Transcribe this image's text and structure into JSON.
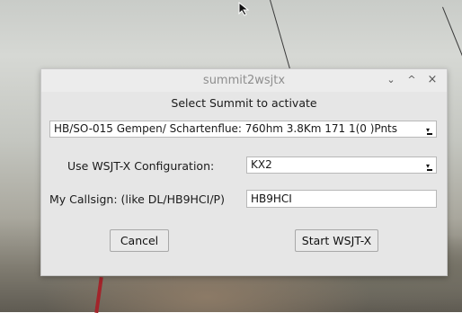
{
  "window": {
    "title": "summit2wsjtx",
    "controls": {
      "minimize": "⌄",
      "maximize": "^",
      "close": "×"
    }
  },
  "heading": "Select Summit to activate",
  "summit_select": {
    "value": "HB/SO-015 Gempen/ Schartenflue: 760hm 3.8Km 171 1(0 )Pnts"
  },
  "config": {
    "label": "Use WSJT-X Configuration:",
    "value": "KX2"
  },
  "callsign": {
    "label": "My Callsign: (like DL/HB9HCI/P)",
    "value": "HB9HCI"
  },
  "buttons": {
    "cancel": "Cancel",
    "start": "Start WSJT-X"
  },
  "colors": {
    "window_bg": "#e6e6e6",
    "title_text": "#8e8e8e"
  }
}
